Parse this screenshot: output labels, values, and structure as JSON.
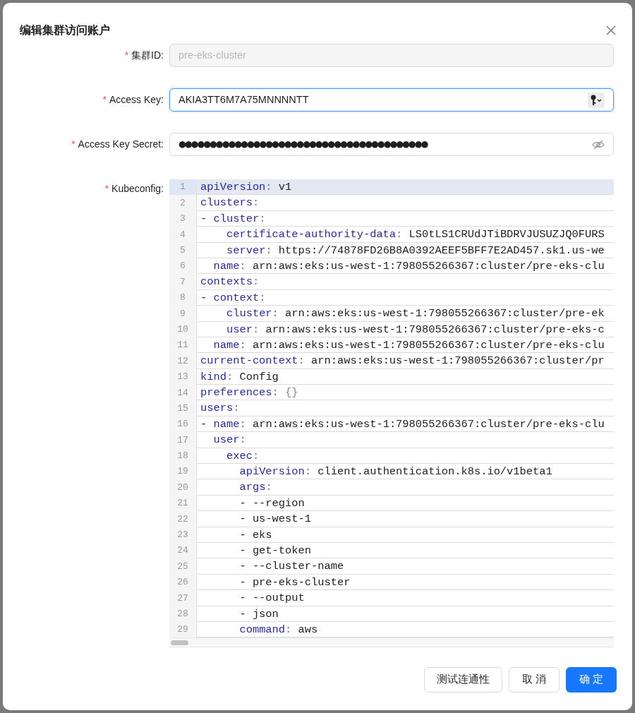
{
  "dialog": {
    "title": "编辑集群访问账户"
  },
  "fields": [
    {
      "label": "集群ID:",
      "marker": "*",
      "kind": "text",
      "value": "pre-eks-cluster",
      "disabled": true,
      "focused": false
    },
    {
      "label": "Access Key:",
      "marker": "*",
      "kind": "key",
      "value": "AKIA3TT6M7A75MNNNNTT",
      "disabled": false,
      "focused": true
    },
    {
      "label": "Access Key Secret:",
      "marker": "*",
      "kind": "password",
      "value": "●●●●●●●●●●●●●●●●●●●●●●●●●●●●●●●●●●●●●●●●",
      "disabled": false,
      "focused": false
    }
  ],
  "kubeconfig": {
    "label": "Kubeconfig:",
    "marker": "*",
    "lines": [
      {
        "number": "1",
        "text": "apiVersion: v1",
        "selected": true
      },
      {
        "number": "2",
        "text": "clusters:",
        "selected": false
      },
      {
        "number": "3",
        "text": "- cluster:",
        "selected": false
      },
      {
        "number": "4",
        "text": "    certificate-authority-data: LS0tLS1CRUdJTiBDRVJUSUZJQ0FURS",
        "selected": false
      },
      {
        "number": "5",
        "text": "    server: https://74878FD26B8A0392AEEF5BFF7E2AD457.sk1.us-we",
        "selected": false
      },
      {
        "number": "6",
        "text": "  name: arn:aws:eks:us-west-1:798055266367:cluster/pre-eks-clu",
        "selected": false
      },
      {
        "number": "7",
        "text": "contexts:",
        "selected": false
      },
      {
        "number": "8",
        "text": "- context:",
        "selected": false
      },
      {
        "number": "9",
        "text": "    cluster: arn:aws:eks:us-west-1:798055266367:cluster/pre-ek",
        "selected": false
      },
      {
        "number": "10",
        "text": "    user: arn:aws:eks:us-west-1:798055266367:cluster/pre-eks-c",
        "selected": false
      },
      {
        "number": "11",
        "text": "  name: arn:aws:eks:us-west-1:798055266367:cluster/pre-eks-clu",
        "selected": false
      },
      {
        "number": "12",
        "text": "current-context: arn:aws:eks:us-west-1:798055266367:cluster/pr",
        "selected": false
      },
      {
        "number": "13",
        "text": "kind: Config",
        "selected": false
      },
      {
        "number": "14",
        "text": "preferences: {}",
        "selected": false
      },
      {
        "number": "15",
        "text": "users:",
        "selected": false
      },
      {
        "number": "16",
        "text": "- name: arn:aws:eks:us-west-1:798055266367:cluster/pre-eks-clu",
        "selected": false
      },
      {
        "number": "17",
        "text": "  user:",
        "selected": false
      },
      {
        "number": "18",
        "text": "    exec:",
        "selected": false
      },
      {
        "number": "19",
        "text": "      apiVersion: client.authentication.k8s.io/v1beta1",
        "selected": false
      },
      {
        "number": "20",
        "text": "      args:",
        "selected": false
      },
      {
        "number": "21",
        "text": "      - --region",
        "selected": false
      },
      {
        "number": "22",
        "text": "      - us-west-1",
        "selected": false
      },
      {
        "number": "23",
        "text": "      - eks",
        "selected": false
      },
      {
        "number": "24",
        "text": "      - get-token",
        "selected": false
      },
      {
        "number": "25",
        "text": "      - --cluster-name",
        "selected": false
      },
      {
        "number": "26",
        "text": "      - pre-eks-cluster",
        "selected": false
      },
      {
        "number": "27",
        "text": "      - --output",
        "selected": false
      },
      {
        "number": "28",
        "text": "      - json",
        "selected": false
      },
      {
        "number": "29",
        "text": "      command: aws",
        "selected": false
      }
    ]
  },
  "buttons": [
    {
      "label": "测试连通性",
      "primary": false
    },
    {
      "label": "取 消",
      "primary": false
    },
    {
      "label": "确 定",
      "primary": true
    }
  ]
}
